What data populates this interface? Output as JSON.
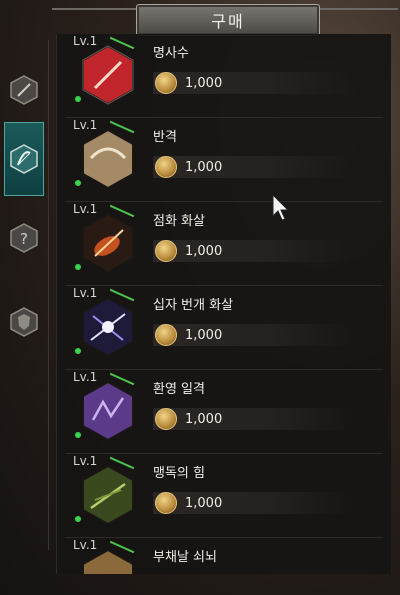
{
  "window": {
    "title": "구매"
  },
  "sidebar": {
    "tabs": [
      {
        "icon": "sword-emblem-icon",
        "active": false
      },
      {
        "icon": "bow-emblem-icon",
        "active": true
      },
      {
        "icon": "question-emblem-icon",
        "active": false
      },
      {
        "icon": "shield-emblem-icon",
        "active": false
      }
    ]
  },
  "skills": [
    {
      "level": "Lv.1",
      "name": "명사수",
      "price": "1,000",
      "color": "#c0262b"
    },
    {
      "level": "Lv.1",
      "name": "반격",
      "price": "1,000",
      "color": "#a48a66"
    },
    {
      "level": "Lv.1",
      "name": "점화 화살",
      "price": "1,000",
      "color": "#c4511f"
    },
    {
      "level": "Lv.1",
      "name": "십자 번개 화살",
      "price": "1,000",
      "color": "#6e62c9"
    },
    {
      "level": "Lv.1",
      "name": "환영 일격",
      "price": "1,000",
      "color": "#5c3a8a"
    },
    {
      "level": "Lv.1",
      "name": "맹독의 힘",
      "price": "1,000",
      "color": "#5a6b2a"
    },
    {
      "level": "Lv.1",
      "name": "부채날 쇠뇌",
      "price": "",
      "color": "#8a6a3a"
    }
  ],
  "colors": {
    "accent_green": "#4ec24b",
    "active_tab": "#1c5a5a"
  }
}
